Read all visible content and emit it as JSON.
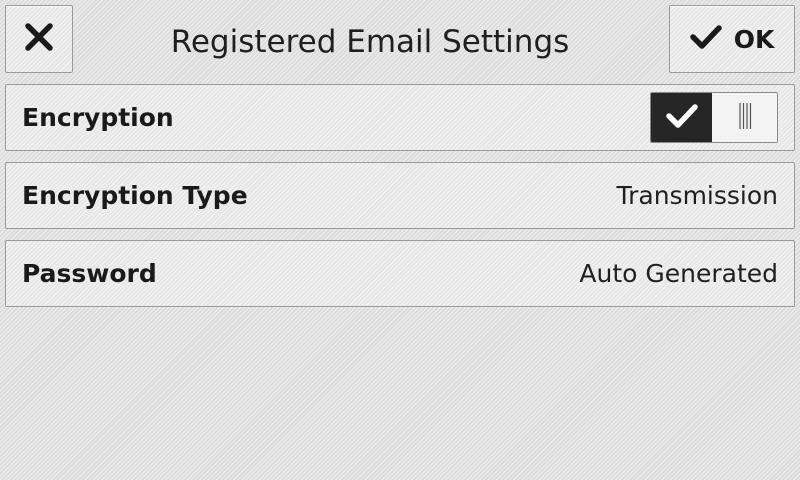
{
  "header": {
    "title": "Registered Email Settings",
    "close_icon": "close-icon",
    "ok_icon": "checkmark-icon",
    "ok_label": "OK"
  },
  "settings": {
    "encryption": {
      "label": "Encryption",
      "toggle_state": "on",
      "toggle_on_icon": "checkmark-icon",
      "toggle_off_icon": "toggle-grip-icon"
    },
    "encryption_type": {
      "label": "Encryption Type",
      "value": "Transmission"
    },
    "password": {
      "label": "Password",
      "value": "Auto Generated"
    }
  },
  "colors": {
    "toggle_on_bg": "#262626",
    "background": "#dcdcdc"
  }
}
